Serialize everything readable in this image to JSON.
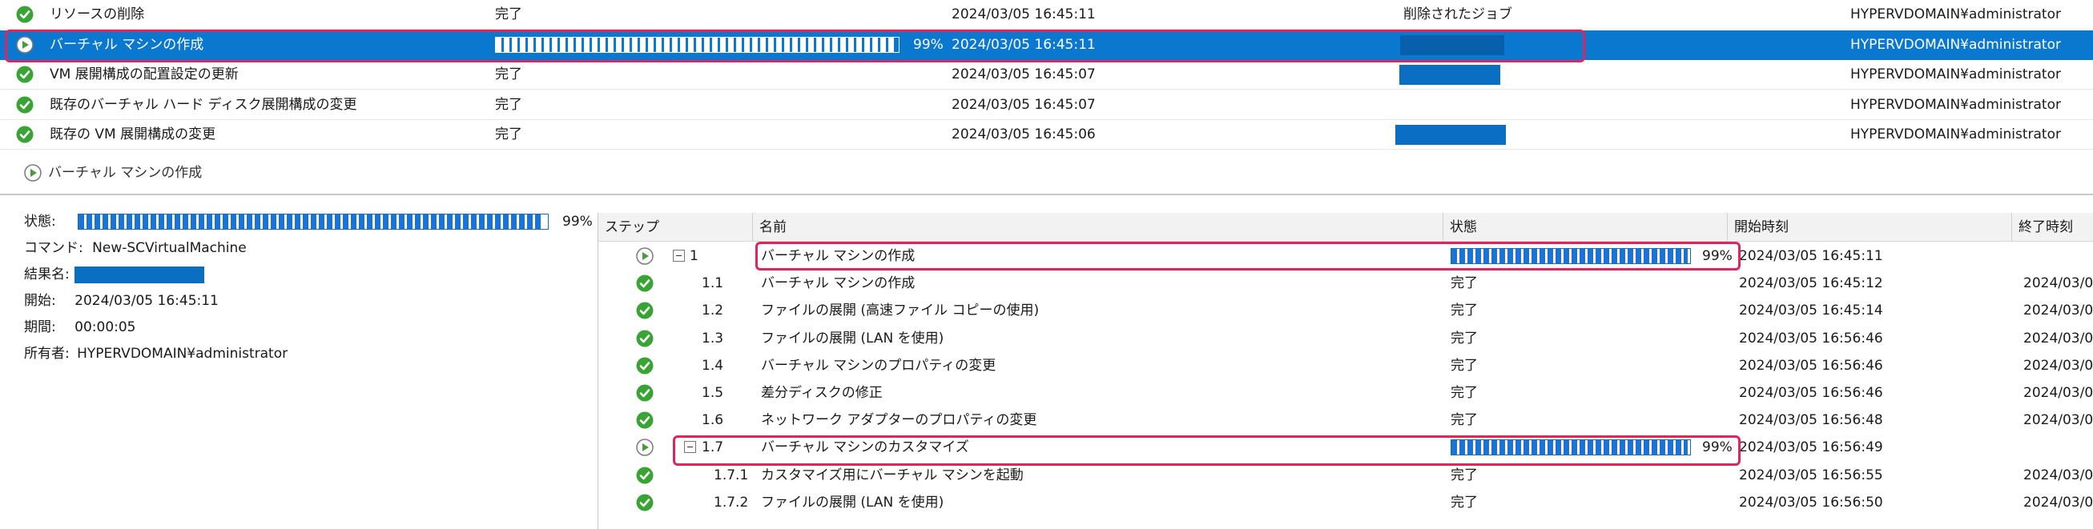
{
  "jobs": [
    {
      "name": "リソースの削除",
      "status": "完了",
      "start": "2024/03/05 16:45:11",
      "result": "削除されたジョブ",
      "owner": "HYPERVDOMAIN¥administrator",
      "icon": "check-icon"
    },
    {
      "name": "バーチャル マシンの作成",
      "status_progress": 0.99,
      "percent": "99%",
      "start": "2024/03/05 16:45:11",
      "owner": "HYPERVDOMAIN¥administrator",
      "icon": "play-icon",
      "selected": true
    },
    {
      "name": "VM 展開構成の配置設定の更新",
      "status": "完了",
      "start": "2024/03/05 16:45:07",
      "owner": "HYPERVDOMAIN¥administrator",
      "icon": "check-icon"
    },
    {
      "name": "既存のバーチャル ハード ディスク展開構成の変更",
      "status": "完了",
      "start": "2024/03/05 16:45:07",
      "owner": "HYPERVDOMAIN¥administrator",
      "icon": "check-icon"
    },
    {
      "name": "既存の VM 展開構成の変更",
      "status": "完了",
      "start": "2024/03/05 16:45:06",
      "owner": "HYPERVDOMAIN¥administrator",
      "icon": "check-icon"
    }
  ],
  "detail": {
    "title": "バーチャル マシンの作成",
    "status_label": "状態:",
    "status_progress": 0.99,
    "status_percent": "99%",
    "command_label": "コマンド:",
    "command_value": "New-SCVirtualMachine",
    "result_label": "結果名:",
    "start_label": "開始:",
    "start_value": "2024/03/05 16:45:11",
    "duration_label": "期間:",
    "duration_value": "00:00:05",
    "owner_label": "所有者:",
    "owner_value": "HYPERVDOMAIN¥administrator"
  },
  "steps_table": {
    "headers": {
      "step": "ステップ",
      "name": "名前",
      "status": "状態",
      "start": "開始時刻",
      "end": "終了時刻"
    },
    "rows": [
      {
        "step": "1",
        "name": "バーチャル マシンの作成",
        "progress": 0.99,
        "percent": "99%",
        "start": "2024/03/05 16:45:11",
        "end": "",
        "icon": "play-icon",
        "expander": true
      },
      {
        "step": "1.1",
        "name": "バーチャル マシンの作成",
        "status": "完了",
        "start": "2024/03/05 16:45:12",
        "end": "2024/03/0",
        "icon": "check-icon"
      },
      {
        "step": "1.2",
        "name": "ファイルの展開 (高速ファイル コピーの使用)",
        "status": "完了",
        "start": "2024/03/05 16:45:14",
        "end": "2024/03/0",
        "icon": "check-icon"
      },
      {
        "step": "1.3",
        "name": "ファイルの展開 (LAN を使用)",
        "status": "完了",
        "start": "2024/03/05 16:56:46",
        "end": "2024/03/0",
        "icon": "check-icon"
      },
      {
        "step": "1.4",
        "name": "バーチャル マシンのプロパティの変更",
        "status": "完了",
        "start": "2024/03/05 16:56:46",
        "end": "2024/03/0",
        "icon": "check-icon"
      },
      {
        "step": "1.5",
        "name": "差分ディスクの修正",
        "status": "完了",
        "start": "2024/03/05 16:56:46",
        "end": "2024/03/0",
        "icon": "check-icon"
      },
      {
        "step": "1.6",
        "name": "ネットワーク アダプターのプロパティの変更",
        "status": "完了",
        "start": "2024/03/05 16:56:48",
        "end": "2024/03/0",
        "icon": "check-icon"
      },
      {
        "step": "1.7",
        "name": "バーチャル マシンのカスタマイズ",
        "progress": 0.99,
        "percent": "99%",
        "start": "2024/03/05 16:56:49",
        "end": "",
        "icon": "play-icon",
        "expander": true
      },
      {
        "step": "1.7.1",
        "name": "カスタマイズ用にバーチャル マシンを起動",
        "status": "完了",
        "start": "2024/03/05 16:56:55",
        "end": "2024/03/0",
        "icon": "check-icon"
      },
      {
        "step": "1.7.2",
        "name": "ファイルの展開 (LAN を使用)",
        "status": "完了",
        "start": "2024/03/05 16:56:50",
        "end": "2024/03/0",
        "icon": "check-icon"
      }
    ]
  },
  "colors": {
    "accent": "#0b78d0",
    "success": "#3aa335",
    "highlight": "#e0245e"
  }
}
